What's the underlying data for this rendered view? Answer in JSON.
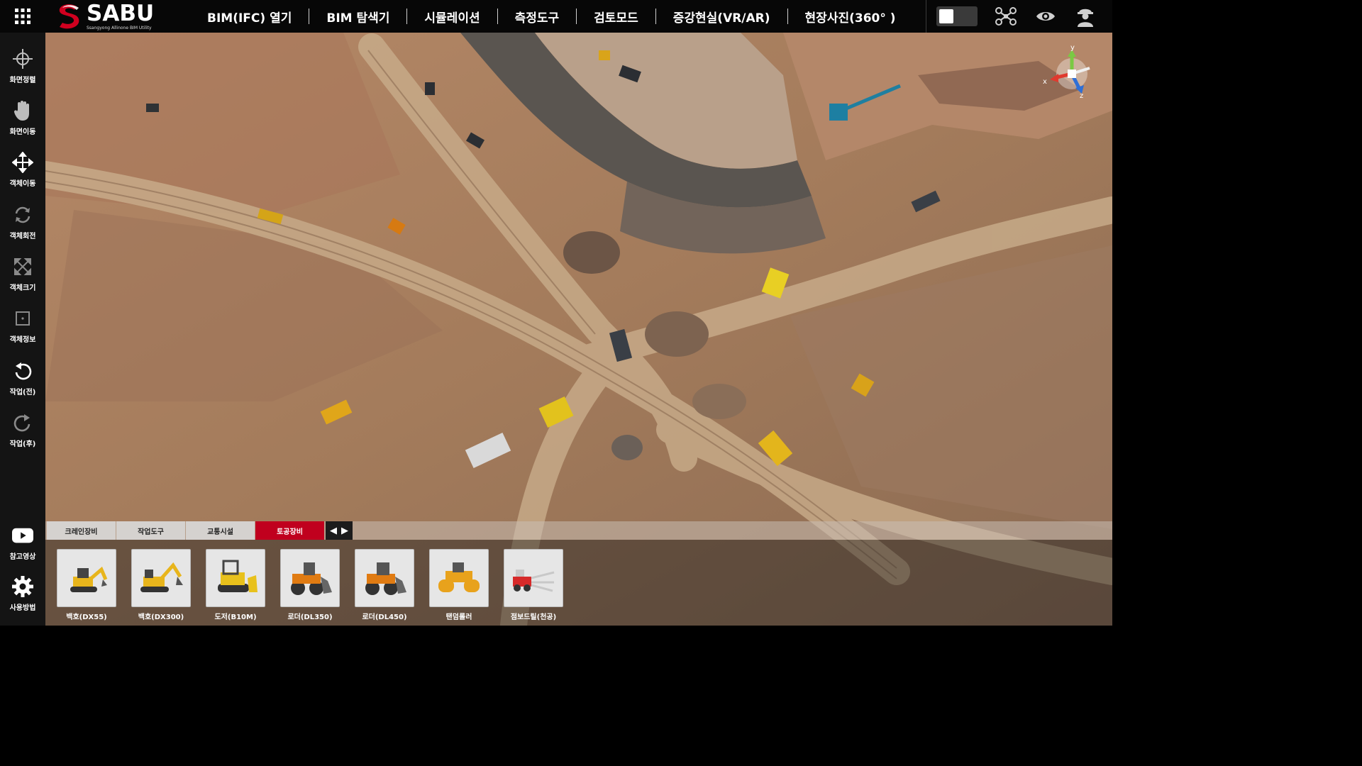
{
  "app": {
    "logo_name": "SABU",
    "logo_subtitle": "Ssangyong Allinone BIM Utility"
  },
  "menu": [
    {
      "label": "BIM(IFC) 열기"
    },
    {
      "label": "BIM 탐색기"
    },
    {
      "label": "시뮬레이션"
    },
    {
      "label": "측정도구"
    },
    {
      "label": "검토모드"
    },
    {
      "label": "증강현실(VR/AR)"
    },
    {
      "label": "현장사진(360° )"
    }
  ],
  "right_tools": {
    "toggle_state": "off",
    "icons": [
      "drone-icon",
      "eye-icon",
      "worker-icon"
    ]
  },
  "sidebar": {
    "items": [
      {
        "label": "화면정렬",
        "icon": "crosshair-icon"
      },
      {
        "label": "화면이동",
        "icon": "hand-icon"
      },
      {
        "label": "객체이동",
        "icon": "move-arrows-icon"
      },
      {
        "label": "객체회전",
        "icon": "rotate-icon"
      },
      {
        "label": "객체크기",
        "icon": "scale-icon"
      },
      {
        "label": "객체정보",
        "icon": "info-box-icon"
      },
      {
        "label": "작업(전)",
        "icon": "undo-icon"
      },
      {
        "label": "작업(후)",
        "icon": "redo-icon"
      }
    ],
    "bottom_items": [
      {
        "label": "참고영상",
        "icon": "youtube-icon"
      },
      {
        "label": "사용방법",
        "icon": "gear-icon"
      }
    ]
  },
  "gizmo": {
    "x_label": "x",
    "y_label": "y",
    "z_label": "z"
  },
  "equipment_tabs": [
    {
      "label": "크레인장비",
      "active": false
    },
    {
      "label": "작업도구",
      "active": false
    },
    {
      "label": "교통시설",
      "active": false
    },
    {
      "label": "토공장비",
      "active": true
    }
  ],
  "tab_nav": {
    "prev": "◀",
    "next": "▶"
  },
  "equipment": [
    {
      "label": "백호(DX55)",
      "icon": "mini-excavator-icon"
    },
    {
      "label": "백호(DX300)",
      "icon": "excavator-icon"
    },
    {
      "label": "도저(B10M)",
      "icon": "bulldozer-icon"
    },
    {
      "label": "로더(DL350)",
      "icon": "wheel-loader-icon"
    },
    {
      "label": "로더(DL450)",
      "icon": "wheel-loader-icon"
    },
    {
      "label": "탠덤롤러",
      "icon": "tandem-roller-icon"
    },
    {
      "label": "점보드릴(천공)",
      "icon": "jumbo-drill-icon"
    }
  ],
  "colors": {
    "accent": "#c0001e",
    "topbar": "#070707",
    "sidebar": "#141414",
    "terrain": "#a67d5b"
  }
}
